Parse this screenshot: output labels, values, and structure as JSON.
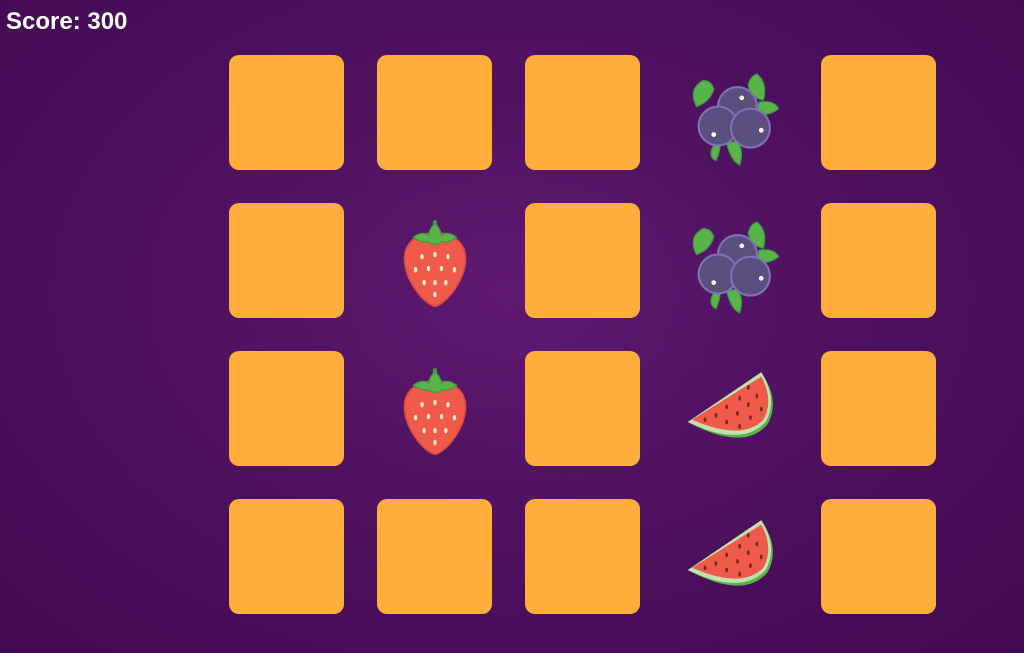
{
  "score_text": "Score: 300",
  "colors": {
    "background": "#4f1160",
    "card_back": "#ffae3c",
    "score_text": "#ffffff"
  },
  "grid": {
    "rows": 4,
    "columns": 5
  },
  "cards": [
    {
      "state": "face-down"
    },
    {
      "state": "face-down"
    },
    {
      "state": "face-down"
    },
    {
      "state": "face-up",
      "fruit": "blueberries"
    },
    {
      "state": "face-down"
    },
    {
      "state": "face-down"
    },
    {
      "state": "face-up",
      "fruit": "strawberry"
    },
    {
      "state": "face-down"
    },
    {
      "state": "face-up",
      "fruit": "blueberries"
    },
    {
      "state": "face-down"
    },
    {
      "state": "face-down"
    },
    {
      "state": "face-up",
      "fruit": "strawberry"
    },
    {
      "state": "face-down"
    },
    {
      "state": "face-up",
      "fruit": "watermelon"
    },
    {
      "state": "face-down"
    },
    {
      "state": "face-down"
    },
    {
      "state": "face-down"
    },
    {
      "state": "face-down"
    },
    {
      "state": "face-up",
      "fruit": "watermelon"
    },
    {
      "state": "face-down"
    }
  ]
}
